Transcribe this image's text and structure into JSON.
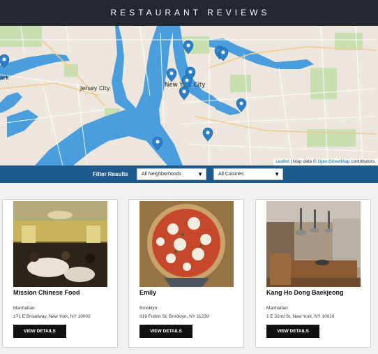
{
  "header": {
    "title": "RESTAURANT REVIEWS"
  },
  "map": {
    "labels": {
      "jersey_city": "Jersey City",
      "new_york_city": "New York City",
      "newark": "ark"
    },
    "attribution": {
      "leaflet": "Leaflet",
      "text_1": " | Map data © ",
      "osm": "OpenStreetMap",
      "text_2": " contributors,"
    },
    "marker_icon": "map-marker-icon"
  },
  "filters": {
    "label": "Filter Results",
    "neighborhood_selected": "All Neighborhoods",
    "cuisine_selected": "All Cuisines",
    "arrow_icon": "triangle-down-icon"
  },
  "restaurants": [
    {
      "name": "Mission Chinese Food",
      "neighborhood": "Manhattan",
      "address": "171 E Broadway, New York, NY 10002",
      "button": "VIEW DETAILS",
      "image": "restaurant-interior-photo"
    },
    {
      "name": "Emily",
      "neighborhood": "Brooklyn",
      "address": "919 Fulton St, Brooklyn, NY 11238",
      "button": "VIEW DETAILS",
      "image": "pizza-photo"
    },
    {
      "name": "Kang Ho Dong Baekjeong",
      "neighborhood": "Manhattan",
      "address": "1 E 32nd St, New York, NY 10016",
      "button": "VIEW DETAILS",
      "image": "korean-bbq-interior-photo"
    }
  ],
  "colors": {
    "header_bg": "#252831",
    "filter_bar_bg": "#1f5b8f",
    "water": "#4a9ede",
    "park": "#c8dfb1",
    "marker": "#2a81cb"
  }
}
